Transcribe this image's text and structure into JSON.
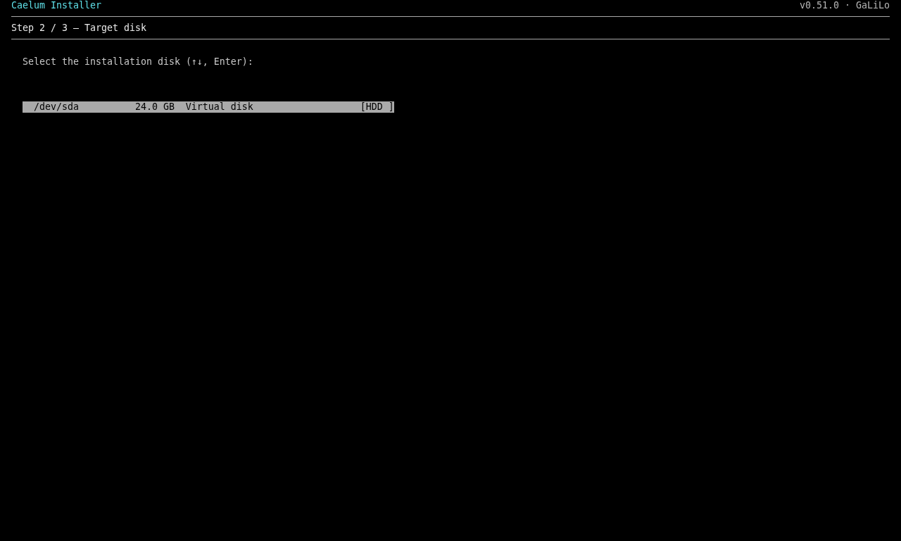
{
  "header": {
    "title": "Caelum Installer",
    "version": "v0.51.0 · GaLiLo"
  },
  "step": {
    "title": "Step 2 / 3 — Target disk"
  },
  "prompt": "Select the installation disk (↑↓, Enter):",
  "disks": [
    {
      "device": "/dev/sda",
      "size": "24.0 GB",
      "description": "Virtual disk",
      "type_tag": "[HDD ]",
      "selected": true
    }
  ]
}
